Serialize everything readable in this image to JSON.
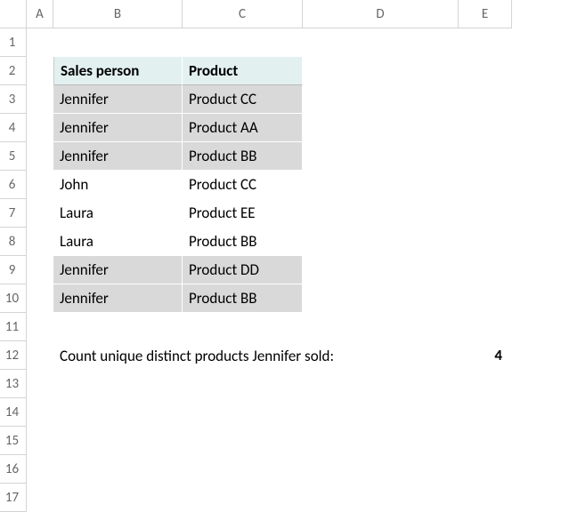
{
  "columns": [
    "A",
    "B",
    "C",
    "D",
    "E"
  ],
  "rows": [
    "1",
    "2",
    "3",
    "4",
    "5",
    "6",
    "7",
    "8",
    "9",
    "10",
    "11",
    "12",
    "13",
    "14",
    "15",
    "16",
    "17"
  ],
  "table": {
    "headers": {
      "b": "Sales person",
      "c": "Product"
    },
    "data": [
      {
        "person": "Jennifer",
        "product": "Product CC",
        "highlight": true
      },
      {
        "person": "Jennifer",
        "product": "Product AA",
        "highlight": true
      },
      {
        "person": "Jennifer",
        "product": "Product BB",
        "highlight": true
      },
      {
        "person": "John",
        "product": "Product CC",
        "highlight": false
      },
      {
        "person": "Laura",
        "product": "Product EE",
        "highlight": false
      },
      {
        "person": "Laura",
        "product": "Product BB",
        "highlight": false
      },
      {
        "person": "Jennifer",
        "product": "Product DD",
        "highlight": true
      },
      {
        "person": "Jennifer",
        "product": "Product BB",
        "highlight": true
      }
    ]
  },
  "summary": {
    "label": "Count unique distinct products  Jennifer sold:",
    "value": "4"
  },
  "chart_data": {
    "type": "table",
    "title": "Count unique distinct products Jennifer sold",
    "columns": [
      "Sales person",
      "Product"
    ],
    "rows": [
      [
        "Jennifer",
        "Product CC"
      ],
      [
        "Jennifer",
        "Product AA"
      ],
      [
        "Jennifer",
        "Product BB"
      ],
      [
        "John",
        "Product CC"
      ],
      [
        "Laura",
        "Product EE"
      ],
      [
        "Laura",
        "Product BB"
      ],
      [
        "Jennifer",
        "Product DD"
      ],
      [
        "Jennifer",
        "Product BB"
      ]
    ],
    "result": {
      "label": "Count unique distinct products Jennifer sold",
      "value": 4
    }
  }
}
